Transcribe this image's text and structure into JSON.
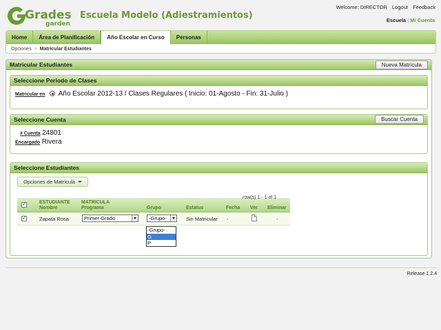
{
  "header": {
    "logo_text": "Grades",
    "logo_subtext": "garden",
    "school_title": "Escuela Modelo (Adiestramientos)",
    "welcome": "Welcome: DIRECTOR",
    "logout": "Logout",
    "feedback": "Feedback",
    "escuela_link": "Escuela",
    "separator": "|",
    "mi_cuenta_link": "Mi Cuenta"
  },
  "nav": {
    "tabs": [
      {
        "label": "Home"
      },
      {
        "label": "Área de Planificación"
      },
      {
        "label": "Año Escolar en Curso"
      },
      {
        "label": "Personas"
      }
    ],
    "active_tab": "Año Escolar en Curso",
    "breadcrumb": {
      "first": "Opciones",
      "separator": ">",
      "current": "Matricular Estudiantes"
    }
  },
  "main": {
    "title": "Matricular Estudiantes",
    "new_button": "Nueva Matrícula",
    "period": {
      "title": "Seleccione Período de Clases",
      "label": "Matricular en",
      "value": "Año Escolar 2012-13 / Clases Regulares ( Inicio: 01-Agosto - Fin: 31-Julio )"
    },
    "account": {
      "title": "Seleccione Cuenta",
      "search_button": "Buscar Cuenta",
      "number_label": "# Cuenta",
      "number_value": "24801",
      "guardian_label": "Encargado",
      "guardian_value": "Rivera"
    },
    "students": {
      "title": "Seleccione Estudiantes",
      "options_button": "Opciones de Matrícula",
      "headers": {
        "estudiante": "ESTUDIANTE",
        "nombre": "Nombre",
        "matricula": "MATRICULA",
        "programa": "Programa",
        "grupo": "Grupo",
        "estatus": "Estatus",
        "fecha": "Fecha",
        "ver": "Ver",
        "eliminar": "Eliminar"
      },
      "row": {
        "checked": "✓",
        "nombre": "Zapata Rosa",
        "programa": "Primer Grado",
        "grupo": "-Grupo-",
        "estatus": "Sin Matricular",
        "fecha": "-",
        "eliminar": "-"
      },
      "header_checked": "✓",
      "grupo_options": [
        "-Grupo-",
        "G",
        "P"
      ],
      "grupo_highlighted": "G",
      "pager": "row(s) 1 - 1 of 1"
    }
  },
  "footer": {
    "release": "Release 1.2.4"
  },
  "colors": {
    "brand_green": "#6c9a34",
    "tab_bar": "#9bc761",
    "highlight_blue": "#3c7fd6"
  }
}
